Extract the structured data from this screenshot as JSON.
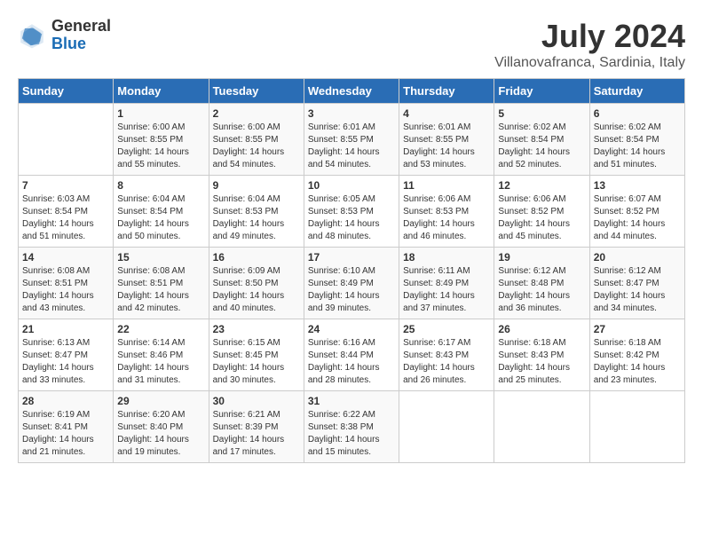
{
  "logo": {
    "general": "General",
    "blue": "Blue"
  },
  "title": "July 2024",
  "subtitle": "Villanovafranca, Sardinia, Italy",
  "header_days": [
    "Sunday",
    "Monday",
    "Tuesday",
    "Wednesday",
    "Thursday",
    "Friday",
    "Saturday"
  ],
  "weeks": [
    [
      {
        "day": "",
        "info": ""
      },
      {
        "day": "1",
        "info": "Sunrise: 6:00 AM\nSunset: 8:55 PM\nDaylight: 14 hours\nand 55 minutes."
      },
      {
        "day": "2",
        "info": "Sunrise: 6:00 AM\nSunset: 8:55 PM\nDaylight: 14 hours\nand 54 minutes."
      },
      {
        "day": "3",
        "info": "Sunrise: 6:01 AM\nSunset: 8:55 PM\nDaylight: 14 hours\nand 54 minutes."
      },
      {
        "day": "4",
        "info": "Sunrise: 6:01 AM\nSunset: 8:55 PM\nDaylight: 14 hours\nand 53 minutes."
      },
      {
        "day": "5",
        "info": "Sunrise: 6:02 AM\nSunset: 8:54 PM\nDaylight: 14 hours\nand 52 minutes."
      },
      {
        "day": "6",
        "info": "Sunrise: 6:02 AM\nSunset: 8:54 PM\nDaylight: 14 hours\nand 51 minutes."
      }
    ],
    [
      {
        "day": "7",
        "info": "Sunrise: 6:03 AM\nSunset: 8:54 PM\nDaylight: 14 hours\nand 51 minutes."
      },
      {
        "day": "8",
        "info": "Sunrise: 6:04 AM\nSunset: 8:54 PM\nDaylight: 14 hours\nand 50 minutes."
      },
      {
        "day": "9",
        "info": "Sunrise: 6:04 AM\nSunset: 8:53 PM\nDaylight: 14 hours\nand 49 minutes."
      },
      {
        "day": "10",
        "info": "Sunrise: 6:05 AM\nSunset: 8:53 PM\nDaylight: 14 hours\nand 48 minutes."
      },
      {
        "day": "11",
        "info": "Sunrise: 6:06 AM\nSunset: 8:53 PM\nDaylight: 14 hours\nand 46 minutes."
      },
      {
        "day": "12",
        "info": "Sunrise: 6:06 AM\nSunset: 8:52 PM\nDaylight: 14 hours\nand 45 minutes."
      },
      {
        "day": "13",
        "info": "Sunrise: 6:07 AM\nSunset: 8:52 PM\nDaylight: 14 hours\nand 44 minutes."
      }
    ],
    [
      {
        "day": "14",
        "info": "Sunrise: 6:08 AM\nSunset: 8:51 PM\nDaylight: 14 hours\nand 43 minutes."
      },
      {
        "day": "15",
        "info": "Sunrise: 6:08 AM\nSunset: 8:51 PM\nDaylight: 14 hours\nand 42 minutes."
      },
      {
        "day": "16",
        "info": "Sunrise: 6:09 AM\nSunset: 8:50 PM\nDaylight: 14 hours\nand 40 minutes."
      },
      {
        "day": "17",
        "info": "Sunrise: 6:10 AM\nSunset: 8:49 PM\nDaylight: 14 hours\nand 39 minutes."
      },
      {
        "day": "18",
        "info": "Sunrise: 6:11 AM\nSunset: 8:49 PM\nDaylight: 14 hours\nand 37 minutes."
      },
      {
        "day": "19",
        "info": "Sunrise: 6:12 AM\nSunset: 8:48 PM\nDaylight: 14 hours\nand 36 minutes."
      },
      {
        "day": "20",
        "info": "Sunrise: 6:12 AM\nSunset: 8:47 PM\nDaylight: 14 hours\nand 34 minutes."
      }
    ],
    [
      {
        "day": "21",
        "info": "Sunrise: 6:13 AM\nSunset: 8:47 PM\nDaylight: 14 hours\nand 33 minutes."
      },
      {
        "day": "22",
        "info": "Sunrise: 6:14 AM\nSunset: 8:46 PM\nDaylight: 14 hours\nand 31 minutes."
      },
      {
        "day": "23",
        "info": "Sunrise: 6:15 AM\nSunset: 8:45 PM\nDaylight: 14 hours\nand 30 minutes."
      },
      {
        "day": "24",
        "info": "Sunrise: 6:16 AM\nSunset: 8:44 PM\nDaylight: 14 hours\nand 28 minutes."
      },
      {
        "day": "25",
        "info": "Sunrise: 6:17 AM\nSunset: 8:43 PM\nDaylight: 14 hours\nand 26 minutes."
      },
      {
        "day": "26",
        "info": "Sunrise: 6:18 AM\nSunset: 8:43 PM\nDaylight: 14 hours\nand 25 minutes."
      },
      {
        "day": "27",
        "info": "Sunrise: 6:18 AM\nSunset: 8:42 PM\nDaylight: 14 hours\nand 23 minutes."
      }
    ],
    [
      {
        "day": "28",
        "info": "Sunrise: 6:19 AM\nSunset: 8:41 PM\nDaylight: 14 hours\nand 21 minutes."
      },
      {
        "day": "29",
        "info": "Sunrise: 6:20 AM\nSunset: 8:40 PM\nDaylight: 14 hours\nand 19 minutes."
      },
      {
        "day": "30",
        "info": "Sunrise: 6:21 AM\nSunset: 8:39 PM\nDaylight: 14 hours\nand 17 minutes."
      },
      {
        "day": "31",
        "info": "Sunrise: 6:22 AM\nSunset: 8:38 PM\nDaylight: 14 hours\nand 15 minutes."
      },
      {
        "day": "",
        "info": ""
      },
      {
        "day": "",
        "info": ""
      },
      {
        "day": "",
        "info": ""
      }
    ]
  ]
}
